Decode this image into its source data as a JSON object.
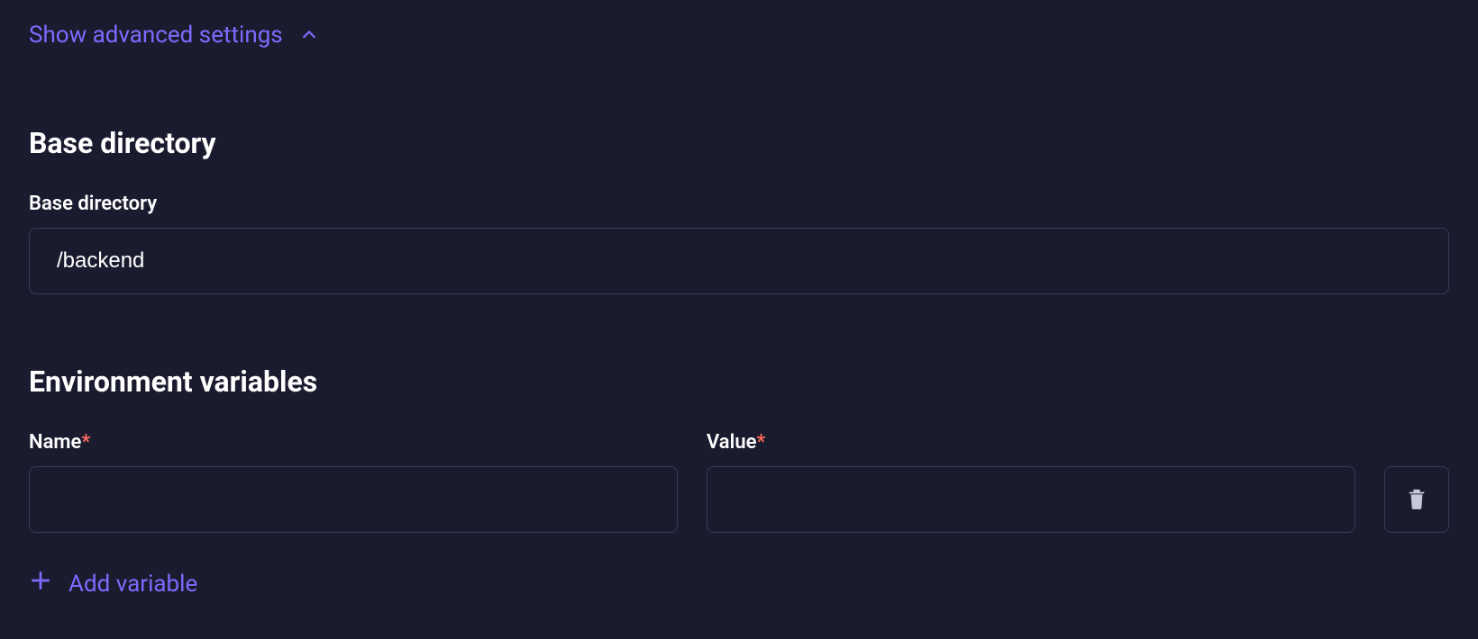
{
  "advanced": {
    "toggle_label": "Show advanced settings"
  },
  "base_directory": {
    "section_title": "Base directory",
    "field_label": "Base directory",
    "value": "/backend"
  },
  "env": {
    "section_title": "Environment variables",
    "name_label": "Name",
    "value_label": "Value",
    "required_mark": "*",
    "rows": [
      {
        "name": "",
        "value": ""
      }
    ],
    "add_label": "Add variable"
  }
}
